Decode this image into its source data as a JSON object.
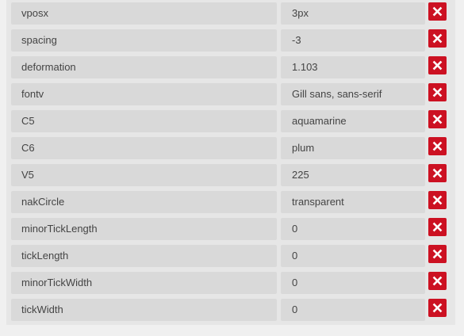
{
  "properties": [
    {
      "key": "vposx",
      "value": "3px"
    },
    {
      "key": "spacing",
      "value": "-3"
    },
    {
      "key": "deformation",
      "value": "1.103"
    },
    {
      "key": "fontv",
      "value": "Gill sans, sans-serif"
    },
    {
      "key": "C5",
      "value": "aquamarine"
    },
    {
      "key": "C6",
      "value": "plum"
    },
    {
      "key": "V5",
      "value": "225"
    },
    {
      "key": "nakCircle",
      "value": "transparent"
    },
    {
      "key": "minorTickLength",
      "value": "0"
    },
    {
      "key": "tickLength",
      "value": "0"
    },
    {
      "key": "minorTickWidth",
      "value": "0"
    },
    {
      "key": "tickWidth",
      "value": "0"
    }
  ],
  "delete_icon": "close-icon",
  "colors": {
    "delete_button": "#cc1122",
    "row_background": "#d9d9d9",
    "panel_background": "#e6e6e6",
    "text": "#444444"
  }
}
